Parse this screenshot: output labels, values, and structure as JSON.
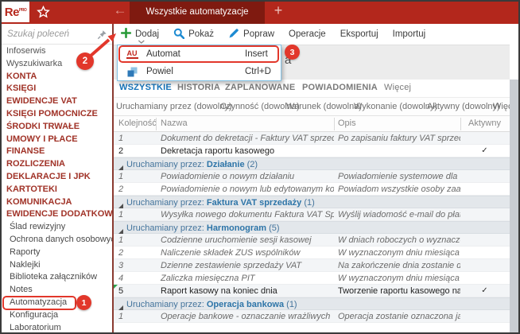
{
  "topbar": {
    "logo_text": "Re",
    "logo_sup": "PRO",
    "active_tab": "Wszystkie automatyzacje",
    "back_glyph": "←",
    "new_tab_glyph": "+"
  },
  "colors": {
    "topbar_red": "#b3271c",
    "active_tab_red": "#7f1a10",
    "accent_blue": "#1573b9",
    "annotation_red": "#e2372b",
    "sidebar_category_red": "#a03227",
    "group_header_bg": "#e3e7eb",
    "group_header_text": "#44749c"
  },
  "sidebar": {
    "search_placeholder": "Szukaj poleceń",
    "items": [
      {
        "label": "Infoserwis",
        "type": "plain"
      },
      {
        "label": "Wyszukiwarka",
        "type": "plain"
      },
      {
        "label": "KONTA",
        "type": "category"
      },
      {
        "label": "KSIĘGI",
        "type": "category"
      },
      {
        "label": "EWIDENCJE VAT",
        "type": "category"
      },
      {
        "label": "KSIĘGI POMOCNICZE",
        "type": "category"
      },
      {
        "label": "ŚRODKI TRWAŁE",
        "type": "category"
      },
      {
        "label": "UMOWY I PŁACE",
        "type": "category"
      },
      {
        "label": "FINANSE",
        "type": "category"
      },
      {
        "label": "ROZLICZENIA",
        "type": "category"
      },
      {
        "label": "DEKLARACJE I JPK",
        "type": "category"
      },
      {
        "label": "KARTOTEKI",
        "type": "category"
      },
      {
        "label": "KOMUNIKACJA",
        "type": "category"
      },
      {
        "label": "EWIDENCJE DODATKOWE",
        "type": "category"
      },
      {
        "label": "Ślad rewizyjny",
        "type": "sub"
      },
      {
        "label": "Ochrona danych osobowych",
        "type": "sub"
      },
      {
        "label": "Raporty",
        "type": "sub"
      },
      {
        "label": "Naklejki",
        "type": "sub"
      },
      {
        "label": "Biblioteka załączników",
        "type": "sub"
      },
      {
        "label": "Notes",
        "type": "sub"
      },
      {
        "label": "Automatyzacja",
        "type": "sub",
        "annotated": true
      },
      {
        "label": "Konfiguracja",
        "type": "sub"
      },
      {
        "label": "Laboratorium",
        "type": "sub"
      }
    ]
  },
  "toolbar": {
    "buttons": [
      {
        "label": "Dodaj",
        "icon": "plus-icon",
        "has_chevron": true
      },
      {
        "label": "Pokaż",
        "icon": "magnifier-icon"
      },
      {
        "label": "Popraw",
        "icon": "pencil-icon"
      },
      {
        "label": "Operacje"
      },
      {
        "label": "Eksportuj"
      },
      {
        "label": "Importuj"
      }
    ]
  },
  "add_menu": {
    "items": [
      {
        "icon": "automat-au-icon",
        "label": "Automat",
        "shortcut": "Insert",
        "annotated": true
      },
      {
        "icon": "copy-icon",
        "label": "Powiel",
        "shortcut": "Ctrl+D"
      }
    ]
  },
  "page": {
    "title_visible_fragment": "a"
  },
  "view_tabs": {
    "items": [
      {
        "label": "WSZYSTKIE",
        "active": true
      },
      {
        "label": "HISTORIA"
      },
      {
        "label": "ZAPLANOWANE"
      },
      {
        "label": "POWIADOMIENIA"
      },
      {
        "label": "Więcej",
        "more": true
      }
    ]
  },
  "filters": {
    "items": [
      "Uruchamiany przez (dowolny)",
      "Czynność (dowolna)",
      "Warunek (dowolna)",
      "Wykonanie (dowolny)",
      "Aktywny (dowolny)",
      "Więcej"
    ]
  },
  "table": {
    "columns": [
      "Kolejność",
      "Nazwa",
      "Opis",
      "Aktywny"
    ],
    "group_prefix": "Uruchamiany przez:",
    "check_glyph": "✓",
    "sections": [
      {
        "trigger": null,
        "rows": [
          {
            "num": "1",
            "name": "Dokument do dekretacji - Faktury VAT sprzedaży",
            "desc": "Po zapisaniu faktury VAT sprzedaży z...",
            "italic": true,
            "active": false
          },
          {
            "num": "2",
            "name": "Dekretacja raportu kasowego",
            "desc": "",
            "italic": false,
            "active": true
          }
        ]
      },
      {
        "trigger": "Działanie",
        "count": "2",
        "rows": [
          {
            "num": "1",
            "name": "Powiadomienie o nowym działaniu",
            "desc": "Powiadomienie systemowe dla wykon...",
            "italic": true,
            "active": false
          },
          {
            "num": "2",
            "name": "Powiadomienie o nowym lub edytowanym komentarzu",
            "desc": "Powiadom wszystkie osoby zaangażo...",
            "italic": true,
            "active": false
          }
        ]
      },
      {
        "trigger": "Faktura VAT sprzedaży",
        "count": "1",
        "rows": [
          {
            "num": "1",
            "name": "Wysyłka nowego dokumentu Faktura VAT Sprzedaży do...",
            "desc": "Wyślij wiadomość e-mail do płatnika...",
            "italic": true,
            "active": false
          }
        ]
      },
      {
        "trigger": "Harmonogram",
        "count": "5",
        "rows": [
          {
            "num": "1",
            "name": "Codzienne uruchomienie sesji kasowej",
            "desc": "W dniach roboczych o wyznaczonej g...",
            "italic": true,
            "active": false
          },
          {
            "num": "2",
            "name": "Naliczenie składek ZUS wspólników",
            "desc": "W wyznaczonym dniu miesiąca zosta...",
            "italic": true,
            "active": false
          },
          {
            "num": "3",
            "name": "Dzienne zestawienie sprzedaży VAT",
            "desc": "Na zakończenie dnia zostanie dodane...",
            "italic": true,
            "active": false
          },
          {
            "num": "4",
            "name": "Zaliczka miesięczna PIT",
            "desc": "W wyznaczonym dniu miesiąca zosta...",
            "italic": true,
            "active": false
          },
          {
            "num": "5",
            "name": "Raport kasowy na koniec dnia",
            "desc": "Tworzenie raportu kasowego na koni...",
            "italic": false,
            "active": true,
            "marker": true
          }
        ]
      },
      {
        "trigger": "Operacja bankowa",
        "count": "1",
        "rows": [
          {
            "num": "1",
            "name": "Operacje bankowe - oznaczanie wrażliwych",
            "desc": "Operacja zostanie oznaczona jako wr...",
            "italic": true,
            "active": false
          }
        ]
      }
    ]
  },
  "annotations": {
    "callouts": [
      {
        "number": "1",
        "target": "Automatyzacja"
      },
      {
        "number": "2",
        "target": "Dodaj"
      },
      {
        "number": "3",
        "target": "Automat"
      }
    ]
  }
}
